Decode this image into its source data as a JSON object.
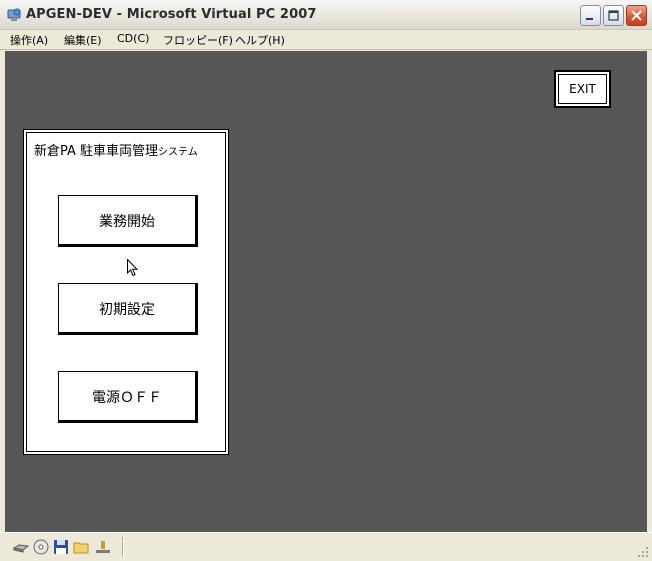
{
  "window": {
    "title": "APGEN-DEV - Microsoft Virtual PC 2007",
    "icon": "virtual-pc-icon",
    "controls": [
      "minimize-icon",
      "maximize-icon",
      "close-icon"
    ]
  },
  "menubar": {
    "items": [
      "操作(A)",
      "編集(E)",
      "CD(C)",
      "フロッピー(F)",
      "ヘルプ(H)"
    ]
  },
  "guest": {
    "exit_label": "EXIT",
    "panel": {
      "title_main": "新倉PA 駐車車両管理",
      "title_small": "システム",
      "buttons": [
        "業務開始",
        "初期設定",
        "電源ＯＦＦ"
      ]
    }
  },
  "statusbar": {
    "icons": [
      "hard-disk-icon",
      "cd-icon",
      "floppy-icon",
      "shared-folder-icon",
      "network-icon"
    ]
  },
  "colors": {
    "guest_background": "#565656",
    "window_chrome": "#ECE9D8",
    "close_button": "#D8522C"
  }
}
